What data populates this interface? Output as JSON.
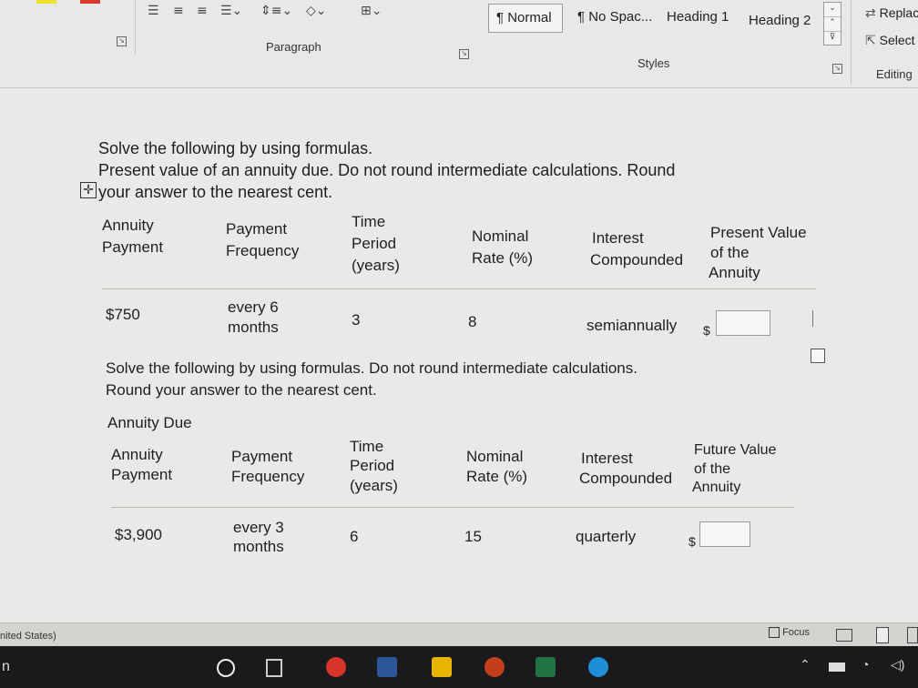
{
  "ribbon": {
    "paragraph_label": "Paragraph",
    "styles_label": "Styles",
    "editing_label": "Editing",
    "styles": [
      {
        "label": "¶ Normal",
        "selected": true
      },
      {
        "label": "¶ No Spac...",
        "selected": false
      },
      {
        "label": "Heading 1",
        "selected": false
      },
      {
        "label": "Heading 2",
        "selected": false
      }
    ],
    "replace_label": "Replac",
    "select_label": "Select"
  },
  "problem1": {
    "line1": "Solve the following by using formulas.",
    "line2": "Present value of an annuity due. Do not round intermediate calculations. Round",
    "line3": "your answer to the nearest cent.",
    "headers": {
      "annuity_payment_1": "Annuity",
      "annuity_payment_2": "Payment",
      "payment_frequency_1": "Payment",
      "payment_frequency_2": "Frequency",
      "time_period_1": "Time",
      "time_period_2": "Period",
      "time_period_3": "(years)",
      "nominal_rate_1": "Nominal",
      "nominal_rate_2": "Rate (%)",
      "interest_compounded_1": "Interest",
      "interest_compounded_2": "Compounded",
      "value_1": "Present Value",
      "value_2": "of the",
      "value_3": "Annuity"
    },
    "row": {
      "annuity_payment": "$750",
      "payment_frequency_1": "every 6",
      "payment_frequency_2": "months",
      "time_period": "3",
      "nominal_rate": "8",
      "interest_compounded": "semiannually",
      "currency": "$",
      "answer": ""
    }
  },
  "problem2": {
    "line1": "Solve the following by using formulas. Do not round intermediate calculations.",
    "line2": "Round your answer to the nearest cent.",
    "subtitle": "Annuity Due",
    "headers": {
      "annuity_payment_1": "Annuity",
      "annuity_payment_2": "Payment",
      "payment_frequency_1": "Payment",
      "payment_frequency_2": "Frequency",
      "time_period_1": "Time",
      "time_period_2": "Period",
      "time_period_3": "(years)",
      "nominal_rate_1": "Nominal",
      "nominal_rate_2": "Rate (%)",
      "interest_compounded_1": "Interest",
      "interest_compounded_2": "Compounded",
      "value_1": "Future Value",
      "value_2": "of the",
      "value_3": "Annuity"
    },
    "row": {
      "annuity_payment": "$3,900",
      "payment_frequency_1": "every 3",
      "payment_frequency_2": "months",
      "time_period": "6",
      "nominal_rate": "15",
      "interest_compounded": "quarterly",
      "currency": "$",
      "answer": ""
    }
  },
  "statusbar": {
    "language": "nited States)",
    "focus_label": "Focus"
  },
  "taskbar": {
    "left_char": "n"
  },
  "colors": {
    "chrome": "#d8342c",
    "word": "#2b579a",
    "excel": "#217346",
    "powerpoint": "#c43e1c",
    "edge": "#1e8fd6",
    "explorer": "#e8b400"
  }
}
